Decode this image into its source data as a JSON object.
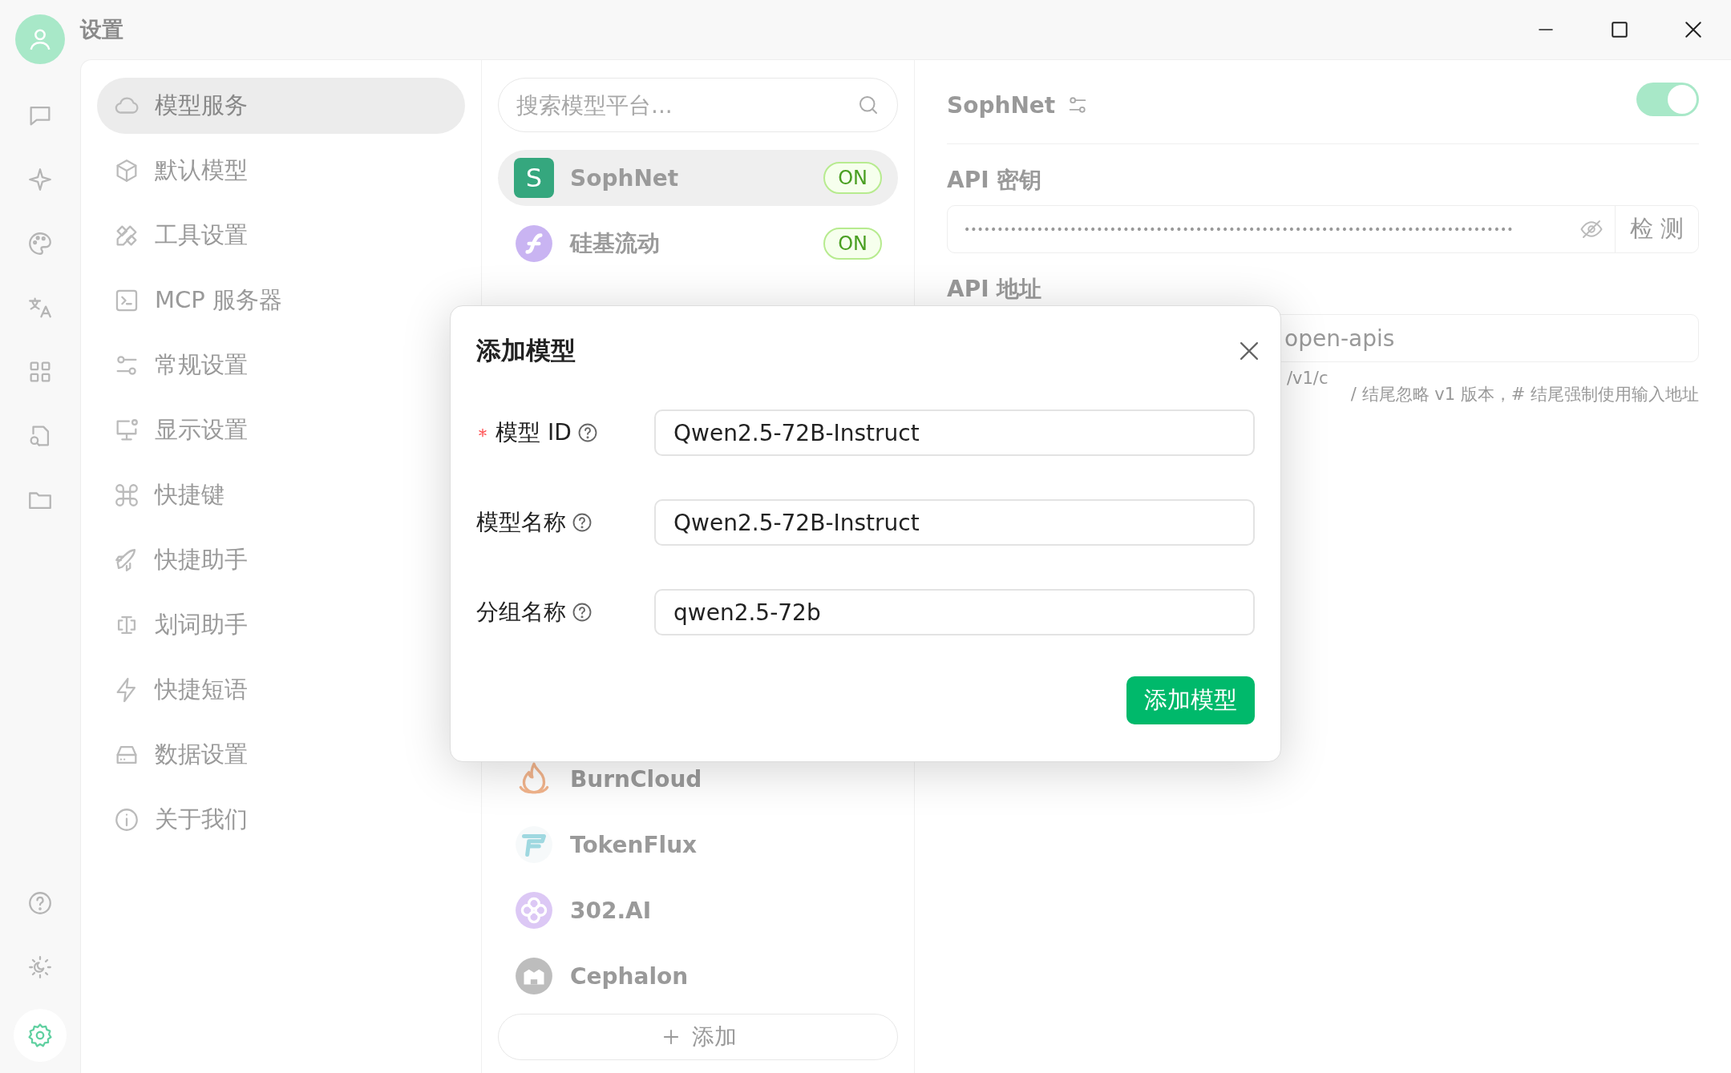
{
  "window": {
    "title": "设置"
  },
  "nav_rail": {
    "top": [
      {
        "kind": "chat",
        "selected": false
      },
      {
        "kind": "sparkle",
        "selected": false
      },
      {
        "kind": "palette",
        "selected": false
      },
      {
        "kind": "translate",
        "selected": false
      },
      {
        "kind": "grid",
        "selected": false
      },
      {
        "kind": "file-search",
        "selected": false
      },
      {
        "kind": "folder",
        "selected": false
      }
    ],
    "bottom": [
      {
        "kind": "help",
        "selected": false
      },
      {
        "kind": "theme",
        "selected": false
      },
      {
        "kind": "settings",
        "selected": true
      }
    ]
  },
  "sidebar": {
    "items": [
      {
        "kind": "cloud",
        "label": "模型服务",
        "selected": true
      },
      {
        "kind": "cube",
        "label": "默认模型",
        "selected": false
      },
      {
        "kind": "tools",
        "label": "工具设置",
        "selected": false
      },
      {
        "kind": "terminal",
        "label": "MCP 服务器",
        "selected": false
      },
      {
        "kind": "sliders",
        "label": "常规设置",
        "selected": false
      },
      {
        "kind": "monitor",
        "label": "显示设置",
        "selected": false
      },
      {
        "kind": "command",
        "label": "快捷键",
        "selected": false
      },
      {
        "kind": "rocket",
        "label": "快捷助手",
        "selected": false
      },
      {
        "kind": "textcursor",
        "label": "划词助手",
        "selected": false
      },
      {
        "kind": "bolt",
        "label": "快捷短语",
        "selected": false
      },
      {
        "kind": "drive",
        "label": "数据设置",
        "selected": false
      },
      {
        "kind": "info",
        "label": "关于我们",
        "selected": false
      }
    ]
  },
  "providers": {
    "search": {
      "placeholder": "搜索模型平台..."
    },
    "items_top": [
      {
        "kind": "letter",
        "letter": "S",
        "name": "SophNet",
        "badge": "ON",
        "selected": true
      },
      {
        "kind": "swirl",
        "name": "硅基流动",
        "badge": "ON",
        "selected": false
      }
    ],
    "items_bottom": [
      {
        "kind": "flame",
        "name": "BurnCloud",
        "selected": false
      },
      {
        "kind": "tokenflux",
        "name": "TokenFlux",
        "selected": false
      },
      {
        "kind": "flower",
        "name": "302.AI",
        "selected": false
      },
      {
        "kind": "cephalon",
        "name": "Cephalon",
        "selected": false
      }
    ],
    "add_button": "添加"
  },
  "detail": {
    "name": "SophNet",
    "enabled": true,
    "api_key_label": "API 密钥",
    "api_key_value": "•••••••••••••••••••••••••••••••••••••••••••••••••••••••••••••••••••••••••••••••••••",
    "check_button": "检 测",
    "api_url_label": "API 地址",
    "api_url_value": "open-apis",
    "hint_1": "/v1/c",
    "hint_2": "/ 结尾忽略 v1 版本，# 结尾强制使用输入地址"
  },
  "dialog": {
    "title": "添加模型",
    "fields": [
      {
        "label": "模型 ID",
        "required": true,
        "value": "Qwen2.5-72B-Instruct"
      },
      {
        "label": "模型名称",
        "required": false,
        "value": "Qwen2.5-72B-Instruct"
      },
      {
        "label": "分组名称",
        "required": false,
        "value": "qwen2.5-72b"
      }
    ],
    "submit": "添加模型"
  }
}
